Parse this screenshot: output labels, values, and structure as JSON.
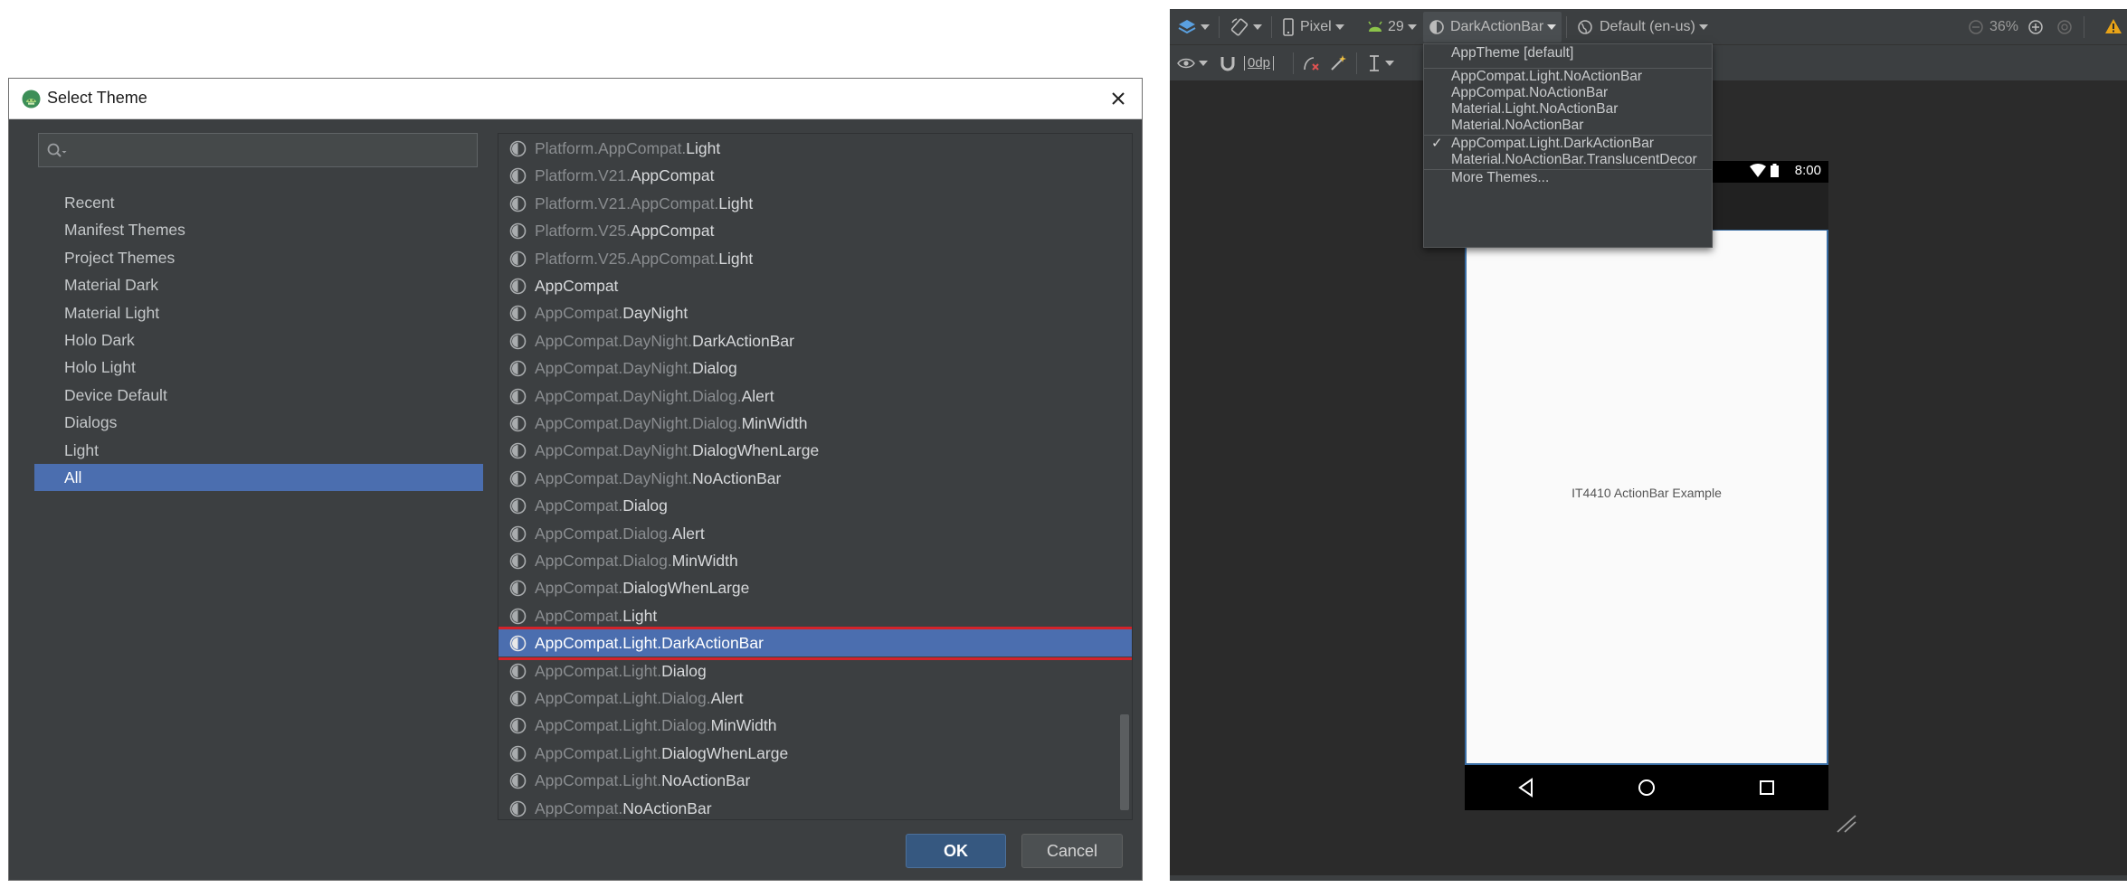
{
  "dialog": {
    "title": "Select Theme",
    "search": {
      "value": "",
      "placeholder": ""
    },
    "categories": [
      {
        "label": "Recent"
      },
      {
        "label": "Manifest Themes"
      },
      {
        "label": "Project Themes"
      },
      {
        "label": "Material Dark"
      },
      {
        "label": "Material Light"
      },
      {
        "label": "Holo Dark"
      },
      {
        "label": "Holo Light"
      },
      {
        "label": "Device Default"
      },
      {
        "label": "Dialogs"
      },
      {
        "label": "Light"
      },
      {
        "label": "All",
        "selected": true
      }
    ],
    "themes": [
      {
        "prefix": "Platform.AppCompat.",
        "name": "Light"
      },
      {
        "prefix": "Platform.V21.",
        "name": "AppCompat"
      },
      {
        "prefix": "Platform.V21.AppCompat.",
        "name": "Light"
      },
      {
        "prefix": "Platform.V25.",
        "name": "AppCompat"
      },
      {
        "prefix": "Platform.V25.AppCompat.",
        "name": "Light"
      },
      {
        "prefix": "",
        "name": "AppCompat"
      },
      {
        "prefix": "AppCompat.",
        "name": "DayNight"
      },
      {
        "prefix": "AppCompat.DayNight.",
        "name": "DarkActionBar"
      },
      {
        "prefix": "AppCompat.DayNight.",
        "name": "Dialog"
      },
      {
        "prefix": "AppCompat.DayNight.Dialog.",
        "name": "Alert"
      },
      {
        "prefix": "AppCompat.DayNight.Dialog.",
        "name": "MinWidth"
      },
      {
        "prefix": "AppCompat.DayNight.",
        "name": "DialogWhenLarge"
      },
      {
        "prefix": "AppCompat.DayNight.",
        "name": "NoActionBar"
      },
      {
        "prefix": "AppCompat.",
        "name": "Dialog"
      },
      {
        "prefix": "AppCompat.Dialog.",
        "name": "Alert"
      },
      {
        "prefix": "AppCompat.Dialog.",
        "name": "MinWidth"
      },
      {
        "prefix": "AppCompat.",
        "name": "DialogWhenLarge"
      },
      {
        "prefix": "AppCompat.",
        "name": "Light"
      },
      {
        "prefix": "AppCompat.Light.",
        "name": "DarkActionBar",
        "selected": true
      },
      {
        "prefix": "AppCompat.Light.",
        "name": "Dialog"
      },
      {
        "prefix": "AppCompat.Light.Dialog.",
        "name": "Alert"
      },
      {
        "prefix": "AppCompat.Light.Dialog.",
        "name": "MinWidth"
      },
      {
        "prefix": "AppCompat.Light.",
        "name": "DialogWhenLarge"
      },
      {
        "prefix": "AppCompat.Light.",
        "name": "NoActionBar"
      },
      {
        "prefix": "AppCompat.",
        "name": "NoActionBar"
      }
    ],
    "ok_label": "OK",
    "cancel_label": "Cancel"
  },
  "editor": {
    "toolbar": {
      "device": "Pixel",
      "api_level": "29",
      "theme": "DarkActionBar",
      "locale": "Default (en-us)",
      "zoom": "36%",
      "margin": "0dp"
    },
    "theme_menu": {
      "items": [
        {
          "label": "AppTheme [default]",
          "checked": false
        },
        {
          "label": "AppCompat.Light.NoActionBar",
          "checked": false
        },
        {
          "label": "AppCompat.NoActionBar",
          "checked": false
        },
        {
          "label": "Material.Light.NoActionBar",
          "checked": false
        },
        {
          "label": "Material.NoActionBar",
          "checked": false
        },
        {
          "label": "AppCompat.Light.DarkActionBar",
          "checked": true
        },
        {
          "label": "Material.NoActionBar.TranslucentDecor",
          "checked": false
        },
        {
          "label": "More Themes...",
          "checked": false
        }
      ]
    },
    "preview": {
      "status_time": "8:00",
      "content_text": "IT4410 ActionBar Example"
    }
  },
  "colors": {
    "dialog_bg": "#3c3f41",
    "selection": "#4b6eaf",
    "highlight_outline": "#d2232a",
    "editor_bg": "#2b2b2b",
    "ok_button": "#365880"
  }
}
